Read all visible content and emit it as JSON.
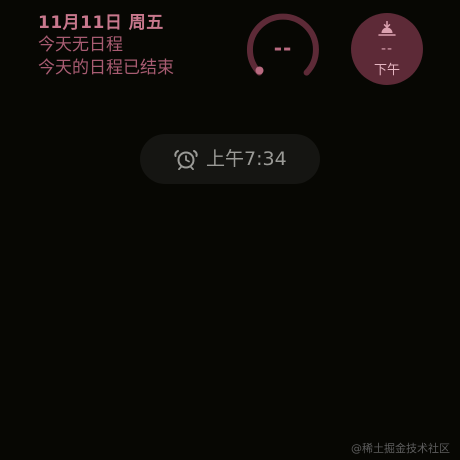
{
  "calendar": {
    "date": "11月11日 周五",
    "line1": "今天无日程",
    "line2": "今天的日程已结束"
  },
  "gauge": {
    "value": "--",
    "ring_color": "#5d2a37",
    "dot_color": "#b86a80"
  },
  "sunset": {
    "icon": "sunset-icon",
    "value": "--",
    "period": "下午"
  },
  "alarm": {
    "icon": "alarm-clock-icon",
    "time": "上午7:34"
  },
  "watermark": {
    "text": "@稀土掘金技术社区"
  },
  "colors": {
    "background": "#070703",
    "accent": "#b86a80",
    "pill": "#151512"
  }
}
